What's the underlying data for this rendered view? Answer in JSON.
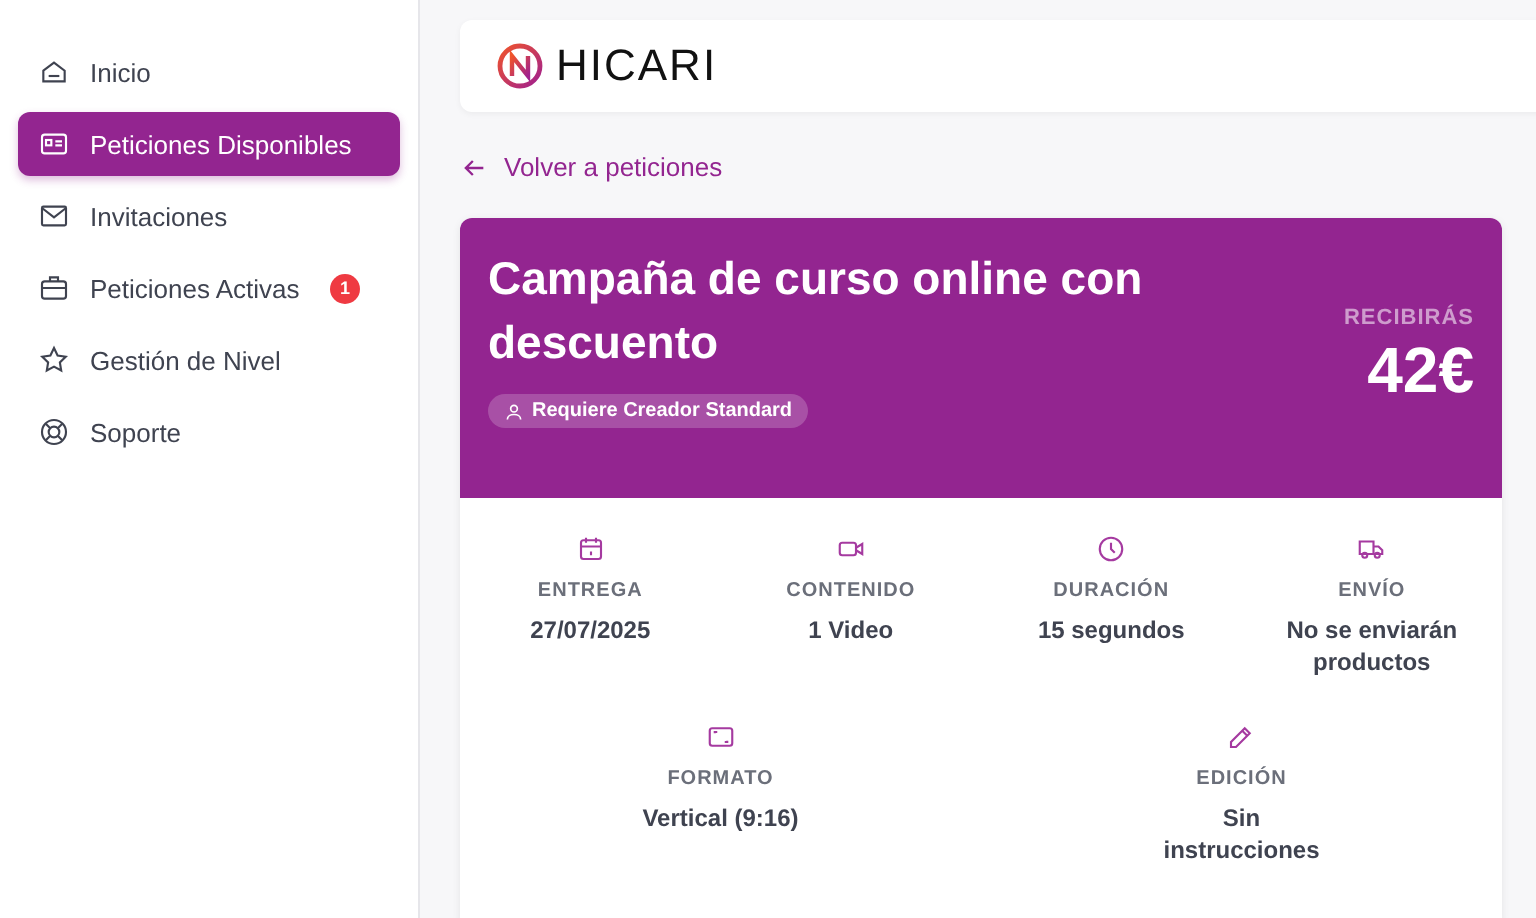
{
  "sidebar": {
    "items": [
      {
        "label": "Inicio",
        "kind": "home",
        "selected": false
      },
      {
        "label": "Peticiones Disponibles",
        "kind": "card",
        "selected": true
      },
      {
        "label": "Invitaciones",
        "kind": "mail",
        "selected": false
      },
      {
        "label": "Peticiones Activas",
        "kind": "briefcase",
        "selected": false,
        "badge": "1"
      },
      {
        "label": "Gestión de Nivel",
        "kind": "star",
        "selected": false
      },
      {
        "label": "Soporte",
        "kind": "lifebuoy",
        "selected": false
      }
    ]
  },
  "header": {
    "logo": "HICARI"
  },
  "back_link": "Volver a peticiones",
  "campaign": {
    "title": "Campaña de curso online con descuento",
    "requirement": "Requiere Creador Standard",
    "payout_label": "RECIBIRÁS",
    "payout": "42€",
    "details": [
      [
        {
          "kind": "calendar",
          "label": "ENTREGA",
          "value": "27/07/2025"
        },
        {
          "kind": "video",
          "label": "CONTENIDO",
          "value": "1 Video"
        },
        {
          "kind": "clock",
          "label": "DURACIÓN",
          "value": "15 segundos"
        },
        {
          "kind": "truck",
          "label": "ENVÍO",
          "value": "No se enviarán productos"
        }
      ],
      [
        {
          "kind": "frame",
          "label": "FORMATO",
          "value": "Vertical (9:16)"
        },
        {
          "kind": "pencil",
          "label": "EDICIÓN",
          "value": "Sin instrucciones"
        }
      ]
    ]
  }
}
